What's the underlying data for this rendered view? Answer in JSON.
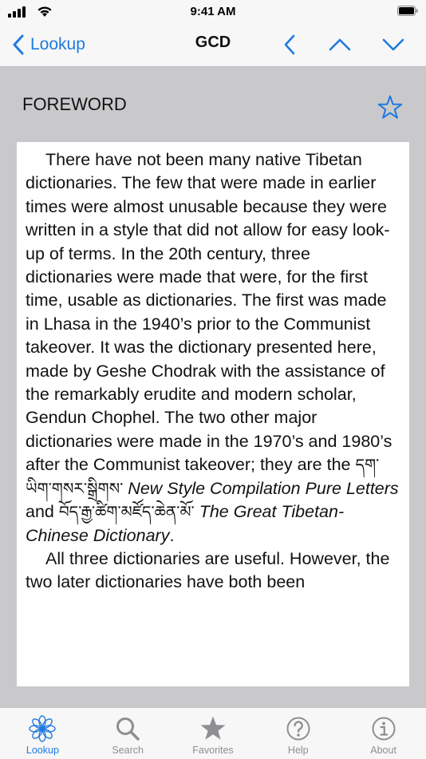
{
  "status_bar": {
    "time": "9:41 AM"
  },
  "nav": {
    "back_label": "Lookup",
    "title": "GCD"
  },
  "section": {
    "title": "FOREWORD"
  },
  "foreword": {
    "p1_a": "There have not been many native Tibetan dictionaries. The few that were made in earlier times were almost unusable because they were written in a style that did not allow for easy look-up of terms. In the 20th century, three dictionaries were made that were, for the first time, usable as dictionaries. The first was made in Lhasa in the 1940’s prior to the Communist takeover. It was the dictionary presented here, made by Geshe Chodrak with the assistance of the remarkably erudite and modern scholar, Gendun Chophel. The two other major dictionaries were made in the 1970’s and 1980’s after the Communist takeover; they are the ",
    "tib_1": "དག་ཡིག་གསར་སྒྲིགས་",
    "title_1": "New Style Compilation Pure Letters",
    "and": " and ",
    "tib_2": "བོད་རྒྱ་ཚིག་མཛོད་ཆེན་མོ་",
    "title_2": "The Great Tibetan-Chinese Dictionary",
    "period": ".",
    "p2": "All three dictionaries are useful. However, the two later dictionaries have both been"
  },
  "tabs": [
    {
      "label": "Lookup",
      "icon": "lookup-flower-icon",
      "active": true
    },
    {
      "label": "Search",
      "icon": "search-icon"
    },
    {
      "label": "Favorites",
      "icon": "star-icon"
    },
    {
      "label": "Help",
      "icon": "help-icon"
    },
    {
      "label": "About",
      "icon": "info-icon"
    }
  ],
  "colors": {
    "accent": "#1f7ae0",
    "inactive": "#8e8e93",
    "background": "#c9c9cc"
  }
}
